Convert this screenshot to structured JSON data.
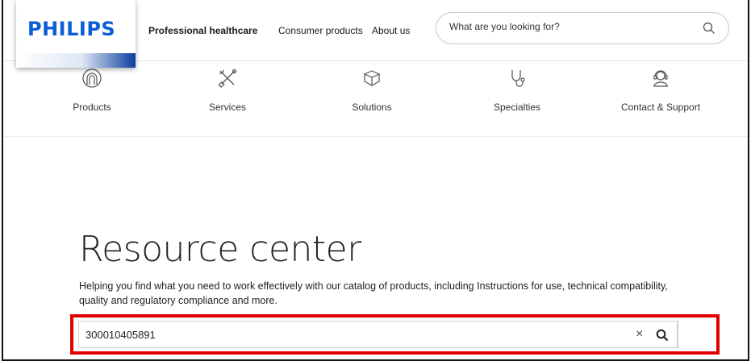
{
  "header": {
    "logo_text": "PHILIPS",
    "nav": [
      {
        "label": "Professional healthcare",
        "active": true
      },
      {
        "label": "Consumer products",
        "active": false
      },
      {
        "label": "About us",
        "active": false
      }
    ],
    "search_placeholder": "What are you looking for?"
  },
  "categories": [
    {
      "label": "Products",
      "icon": "products-icon"
    },
    {
      "label": "Services",
      "icon": "tools-icon"
    },
    {
      "label": "Solutions",
      "icon": "cube-icon"
    },
    {
      "label": "Specialties",
      "icon": "stethoscope-icon"
    },
    {
      "label": "Contact & Support",
      "icon": "headset-icon"
    }
  ],
  "hero": {
    "title": "Resource center",
    "description": "Helping you find what you need to work effectively with our catalog of products, including Instructions for use, technical compatibility, quality and regulatory compliance and more."
  },
  "resource_search": {
    "value": "300010405891",
    "clear_label": "×"
  },
  "colors": {
    "brand": "#0b5ed7",
    "highlight": "#e00000"
  }
}
